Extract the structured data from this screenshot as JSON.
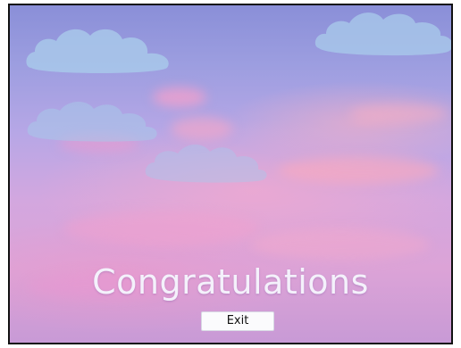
{
  "screen": {
    "title": "Congratulations",
    "exit_label": "Exit"
  },
  "icons": {
    "cloud": "cloud-icon"
  },
  "colors": {
    "sky_top": "#8a8fd8",
    "sky_bottom": "#dca3d7",
    "cloud": "#a8c8ea",
    "title_text": "#f4f1fb",
    "button_bg": "#fbfbfd"
  }
}
